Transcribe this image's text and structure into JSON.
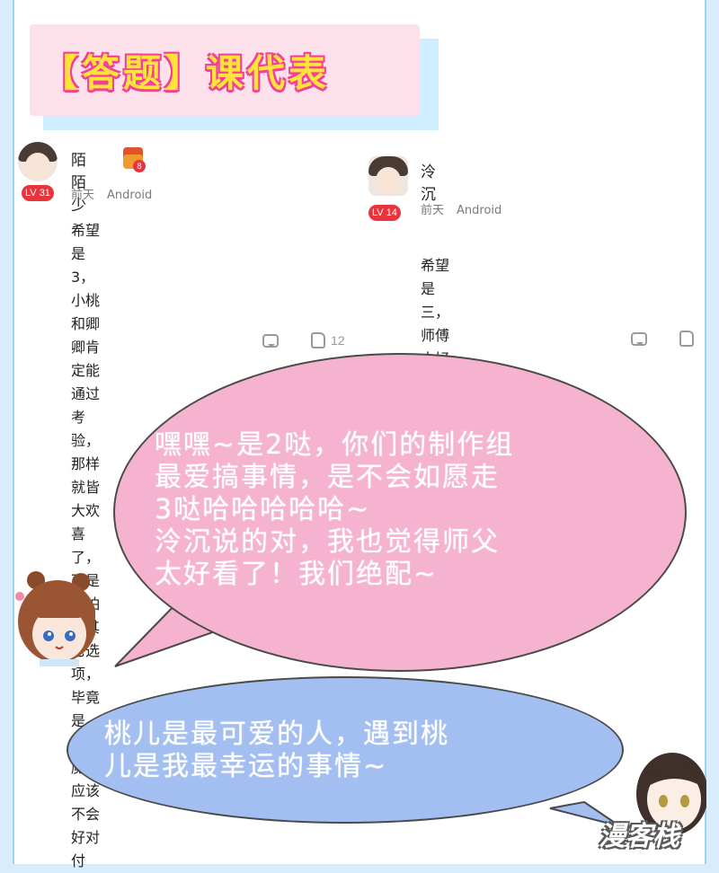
{
  "title": "【答题】课代表",
  "comments": [
    {
      "username": "陌陌少",
      "level": "LV 31",
      "gift_count": "8",
      "time": "前天",
      "device": "Android",
      "content_lines": [
        "希望是3，小桃和卿卿肯定能通过考验，那样",
        "就皆大欢喜了，可是我怕是其它选项，毕竟是",
        "心魔，应该不会好对付"
      ],
      "likes": "12"
    },
    {
      "username": "泠沉",
      "level": "LV 14",
      "time": "前天",
      "device": "Android",
      "content_lines": [
        "希望是三，师傅太好看了，和小桃极配的"
      ],
      "likes": ""
    }
  ],
  "pink_bubble_lines": [
    "嘿嘿~是2哒，你们的制作组",
    "最爱搞事情，是不会如愿走",
    "3哒哈哈哈哈哈~",
    "泠沉说的对，我也觉得师父",
    "太好看了！我们绝配~"
  ],
  "blue_bubble_lines": [
    "桃儿是最可爱的人，遇到桃",
    "儿是我最幸运的事情~"
  ],
  "watermark": "漫客栈",
  "colors": {
    "background": "#d8ecfb",
    "pink_bubble": "#f6b3cf",
    "blue_bubble": "#a3bff1",
    "level_badge": "#e8343b",
    "title_text": "#ffe33a",
    "title_outline": "#f0409a"
  },
  "icons": [
    "comment-icon",
    "like-icon",
    "gift-icon"
  ]
}
